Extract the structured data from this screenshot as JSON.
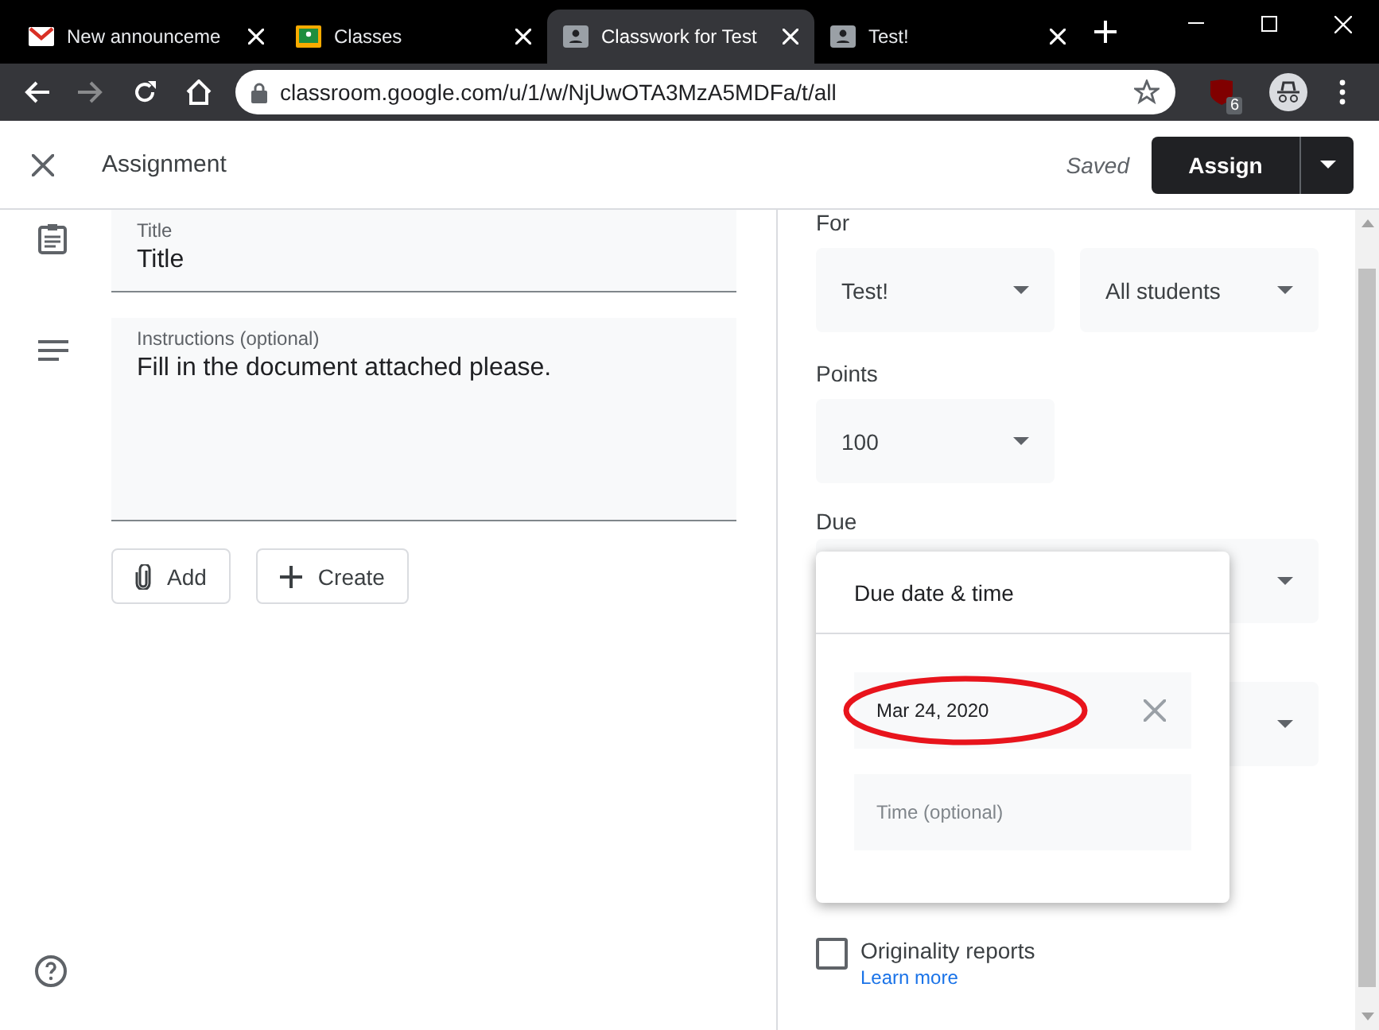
{
  "browser": {
    "tabs": [
      {
        "title": "New announceme",
        "kind": "gmail",
        "selected": false
      },
      {
        "title": "Classes",
        "kind": "classroom",
        "selected": false
      },
      {
        "title": "Classwork for Test",
        "kind": "person",
        "selected": true
      },
      {
        "title": "Test!",
        "kind": "person",
        "selected": false
      }
    ],
    "url": "classroom.google.com/u/1/w/NjUwOTA3MzA5MDFa/t/all",
    "extension_badge": "6"
  },
  "header": {
    "title": "Assignment",
    "status": "Saved",
    "primary_button": "Assign"
  },
  "form": {
    "title": {
      "label": "Title",
      "value": "Title"
    },
    "instructions": {
      "label": "Instructions (optional)",
      "value": "Fill in the document attached please."
    },
    "buttons": [
      {
        "label": "Add",
        "kind": "attach"
      },
      {
        "label": "Create",
        "kind": "create"
      }
    ]
  },
  "settings": {
    "for": {
      "label": "For",
      "class": "Test!",
      "students": "All students"
    },
    "points": {
      "label": "Points",
      "value": "100"
    },
    "due": {
      "label": "Due"
    },
    "originality": {
      "label": "Originality reports",
      "checked": false,
      "link": "Learn more"
    }
  },
  "due_popup": {
    "title": "Due date & time",
    "date": "Mar 24, 2020",
    "time_placeholder": "Time (optional)"
  }
}
